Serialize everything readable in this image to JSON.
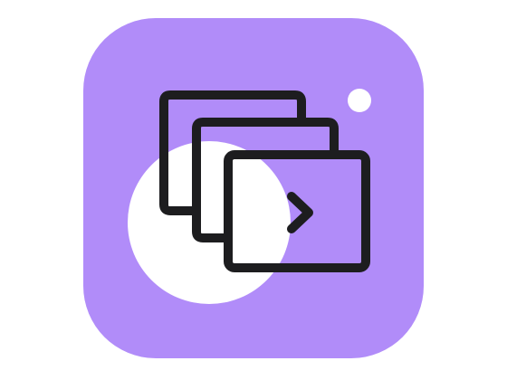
{
  "colors": {
    "background": "#ffffff",
    "tile": "#b18cf9",
    "circle": "#ffffff",
    "stroke": "#1d1d1f",
    "dot": "#ffffff"
  },
  "icons": {
    "app": "slideshow-app-icon",
    "frames": "stacked-frames-icon",
    "arrow": "chevron-right-icon"
  }
}
